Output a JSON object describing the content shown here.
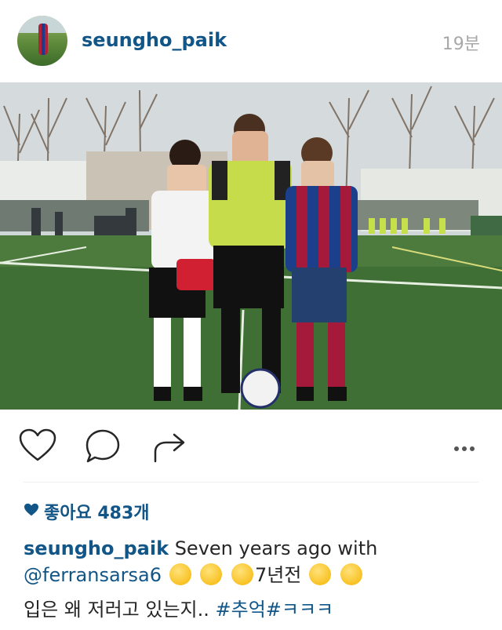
{
  "post": {
    "username": "seungho_paik",
    "time": "19분",
    "photo_desc_icon": "photo",
    "likes_label": "좋아요 483개",
    "caption": {
      "user": "seungho_paik",
      "text1": " Seven years ago with",
      "mention": "@ferransarsa6",
      "text2": "7년전",
      "line3_text": "입은 왜 저러고 있는지.. ",
      "tag1": "#추억",
      "tag2": "#ㅋㅋㅋ"
    },
    "icons": {
      "like": "heart-icon",
      "comment": "comment-icon",
      "share": "share-icon",
      "more": "more-icon"
    },
    "colors": {
      "link": "#125688",
      "time": "#a8a8a8",
      "text": "#262626"
    }
  }
}
